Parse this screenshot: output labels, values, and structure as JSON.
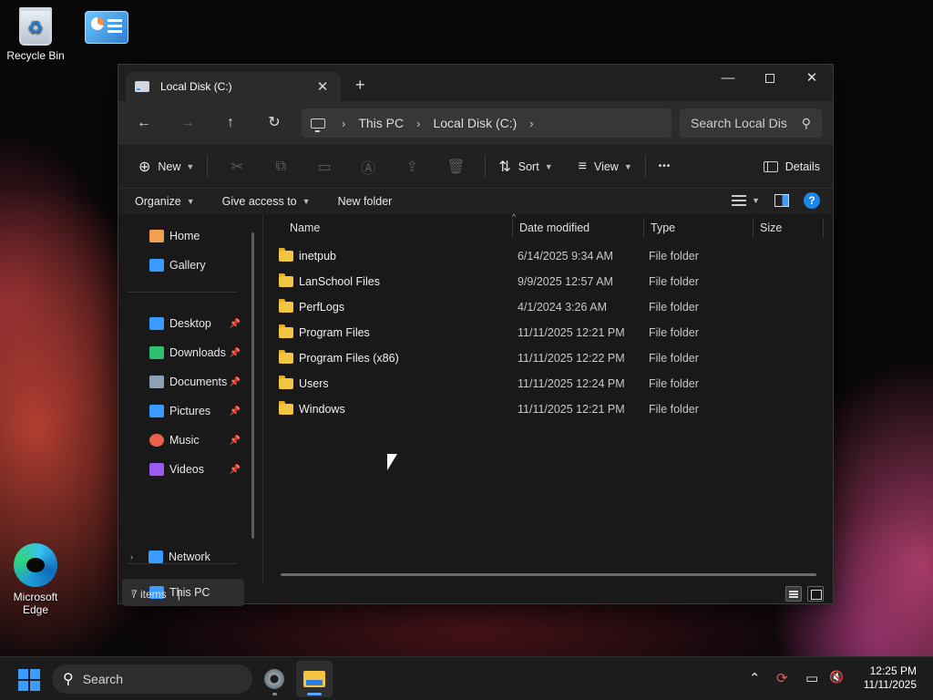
{
  "desktop": {
    "recycle_bin_label": "Recycle Bin",
    "edge_label": "Microsoft Edge"
  },
  "window": {
    "tab_title": "Local Disk (C:)",
    "tab_close": "✕",
    "tab_add": "+",
    "controls": {
      "minimize": "—",
      "close": "✕"
    }
  },
  "nav": {
    "back": "←",
    "forward": "→",
    "up": "↑",
    "refresh": "↻",
    "breadcrumb": [
      "This PC",
      "Local Disk (C:)"
    ],
    "chevron": "›",
    "search_placeholder": "Search Local Dis",
    "search_icon": "⚲"
  },
  "toolbar": {
    "new_label": "New",
    "sort_label": "Sort",
    "view_label": "View",
    "more": "•••",
    "details_label": "Details",
    "icons": {
      "new": "⊕",
      "cut": "✂",
      "copy": "⧉",
      "paste": "▭",
      "rename": "Ⓐ",
      "share": "⇪",
      "delete": "🗑",
      "sort": "⇅",
      "view": "≡"
    }
  },
  "commandbar": {
    "organize": "Organize",
    "give_access": "Give access to",
    "new_folder": "New folder",
    "help": "?"
  },
  "sidebar": {
    "items": [
      {
        "label": "Home",
        "icon": "home-icon",
        "color": "#f0a050"
      },
      {
        "label": "Gallery",
        "icon": "gallery-icon",
        "color": "#3a9cff"
      },
      {
        "label": "Desktop",
        "icon": "desktop-icon",
        "color": "#3a9cff",
        "pinned": true
      },
      {
        "label": "Downloads",
        "icon": "downloads-icon",
        "color": "#2fbf71",
        "pinned": true
      },
      {
        "label": "Documents",
        "icon": "documents-icon",
        "color": "#8fa2b5",
        "pinned": true
      },
      {
        "label": "Pictures",
        "icon": "pictures-icon",
        "color": "#3a9cff",
        "pinned": true
      },
      {
        "label": "Music",
        "icon": "music-icon",
        "color": "#e8634a",
        "pinned": true
      },
      {
        "label": "Videos",
        "icon": "videos-icon",
        "color": "#9a5cf0",
        "pinned": true
      },
      {
        "label": "This PC",
        "icon": "this-pc-icon",
        "color": "#3a9cff",
        "selected": true
      },
      {
        "label": "Network",
        "icon": "network-icon",
        "color": "#3a9cff"
      }
    ],
    "pin_glyph": "📌",
    "expander_glyph": "›"
  },
  "filelist": {
    "columns": [
      "Name",
      "Date modified",
      "Type",
      "Size"
    ],
    "sort_indicator": "^",
    "rows": [
      {
        "name": "inetpub",
        "date": "6/14/2025 9:34 AM",
        "type": "File folder"
      },
      {
        "name": "LanSchool Files",
        "date": "9/9/2025 12:57 AM",
        "type": "File folder"
      },
      {
        "name": "PerfLogs",
        "date": "4/1/2024 3:26 AM",
        "type": "File folder"
      },
      {
        "name": "Program Files",
        "date": "11/11/2025 12:21 PM",
        "type": "File folder"
      },
      {
        "name": "Program Files (x86)",
        "date": "11/11/2025 12:22 PM",
        "type": "File folder"
      },
      {
        "name": "Users",
        "date": "11/11/2025 12:24 PM",
        "type": "File folder"
      },
      {
        "name": "Windows",
        "date": "11/11/2025 12:21 PM",
        "type": "File folder"
      }
    ]
  },
  "statusbar": {
    "item_count": "7 items",
    "caret": "|"
  },
  "taskbar": {
    "search_label": "Search",
    "search_icon": "⚲",
    "tray": {
      "chevron": "⌃",
      "sync": "⟳",
      "display": "▭",
      "volume": "🔇"
    },
    "time": "12:25 PM",
    "date": "11/11/2025"
  }
}
